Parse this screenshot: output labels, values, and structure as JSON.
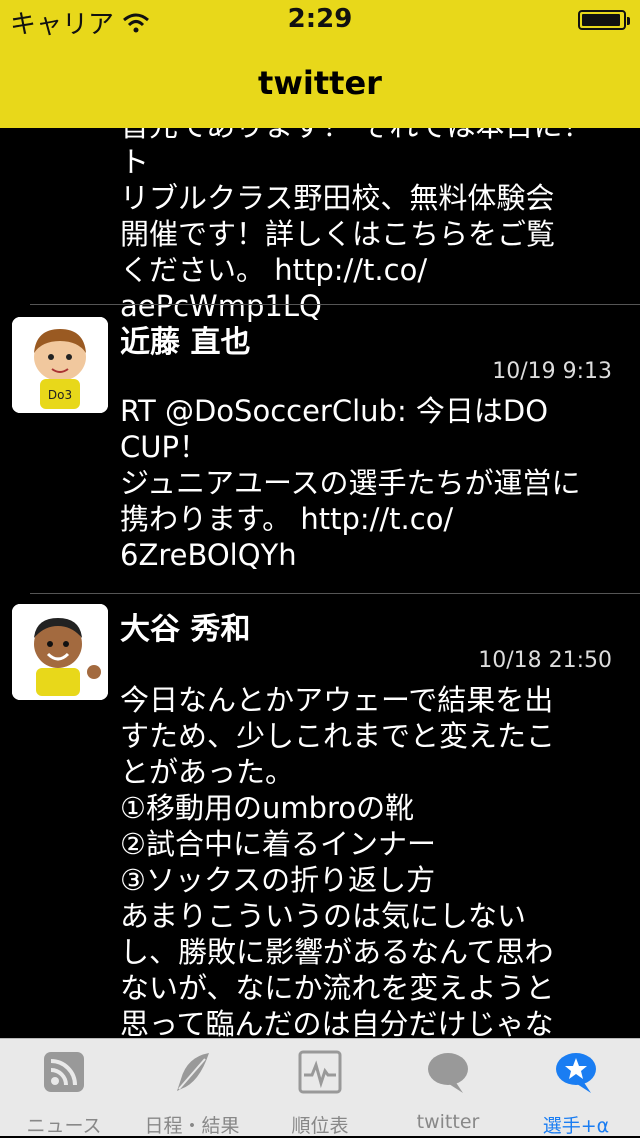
{
  "status_bar": {
    "carrier": "キャリア",
    "time": "2:29",
    "battery_level": 0.8
  },
  "nav": {
    "title": "twitter"
  },
  "tweets": [
    {
      "text": "皆元てあります！ それでは本日に！ト\nリブルクラス野田校、無料体験会\n開催です！詳しくはこちらをご覧\nください。 http://t.co/\naePcWmp1LQ"
    },
    {
      "name": "近藤 直也",
      "date": "10/19 9:13",
      "text": "RT @DoSoccerClub: 今日はDO\nCUP！\nジュニアユースの選手たちが運営に\n携わります。 http://t.co/\n6ZreBOlQYh"
    },
    {
      "name": "大谷 秀和",
      "date": "10/18 21:50",
      "text": "今日なんとかアウェーで結果を出\nすため、少しこれまでと変えたこ\nとがあった。\n①移動用のumbroの靴\n②試合中に着るインナー\n③ソックスの折り返し方\nあまりこういうのは気にしない\nし、勝敗に影響があるなんて思わ\nないが、なにか流れを変えようと\n思って臨んだのは自分だけじゃな"
    }
  ],
  "tabs": [
    {
      "label": "ニュース",
      "icon": "rss-icon"
    },
    {
      "label": "日程・結果",
      "icon": "feather-icon"
    },
    {
      "label": "順位表",
      "icon": "pulse-chart-icon"
    },
    {
      "label": "twitter",
      "icon": "speech-bubble-icon"
    },
    {
      "label": "選手+α",
      "icon": "star-bubble-icon"
    }
  ],
  "colors": {
    "bar_yellow": "#e8d81a",
    "active_blue": "#1a7df2",
    "inactive_gray": "#888888"
  }
}
